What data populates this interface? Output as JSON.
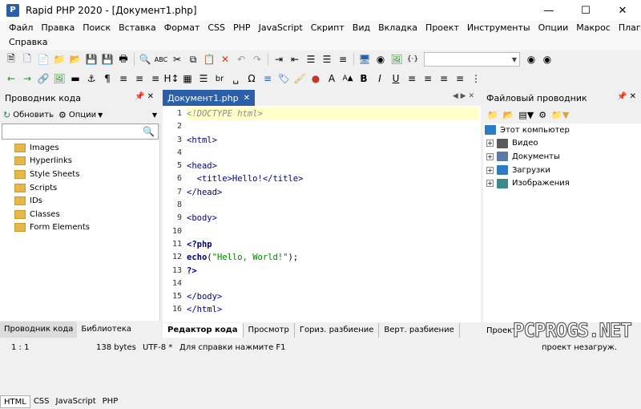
{
  "window": {
    "title": "Rapid PHP 2020 - [Документ1.php]",
    "app_icon": "P"
  },
  "menu": {
    "row1": [
      "Файл",
      "Правка",
      "Поиск",
      "Вставка",
      "Формат",
      "CSS",
      "PHP",
      "JavaScript",
      "Скрипт",
      "Вид",
      "Вкладка",
      "Проект",
      "Инструменты",
      "Опции",
      "Макрос",
      "Плагины"
    ],
    "row2": [
      "Справка"
    ]
  },
  "left_panel": {
    "title": "Проводник кода",
    "refresh_label": "Обновить",
    "options_label": "Опции",
    "items": [
      "Images",
      "Hyperlinks",
      "Style Sheets",
      "Scripts",
      "IDs",
      "Classes",
      "Form Elements"
    ],
    "lang_tabs": [
      "HTML",
      "CSS",
      "JavaScript",
      "PHP"
    ],
    "bottom_tabs": [
      "Проводник кода",
      "Библиотека"
    ]
  },
  "editor": {
    "tab_label": "Документ1.php",
    "line_numbers": [
      "1",
      "2",
      "3",
      "4",
      "5",
      "6",
      "7",
      "8",
      "9",
      "10",
      "11",
      "12",
      "13",
      "14",
      "15",
      "16"
    ],
    "lines": [
      "<!DOCTYPE html>",
      "",
      "<html>",
      "",
      "<head>",
      "  <title>Hello!</title>",
      "</head>",
      "",
      "<body>",
      "",
      "<?php",
      "echo(\"Hello, World!\");",
      "?>",
      "",
      "</body>",
      "</html>"
    ],
    "bottom_tabs": [
      "Редактор кода",
      "Просмотр",
      "Гориз. разбиение",
      "Верт. разбиение"
    ]
  },
  "right_panel": {
    "title": "Файловый проводник",
    "root": "Этот компьютер",
    "items": [
      "Видео",
      "Документы",
      "Загрузки",
      "Изображения"
    ],
    "bottom_label": "Проект"
  },
  "statusbar": {
    "position": "1 : 1",
    "size": "138 bytes",
    "encoding": "UTF-8 *",
    "help": "Для справки нажмите F1",
    "project": "проект незагруж."
  },
  "watermark": "PCPROGS.NET",
  "colors": {
    "accent": "#2b5fa8",
    "highlight_line": "#ffffc8",
    "folder": "#e6b84c"
  }
}
